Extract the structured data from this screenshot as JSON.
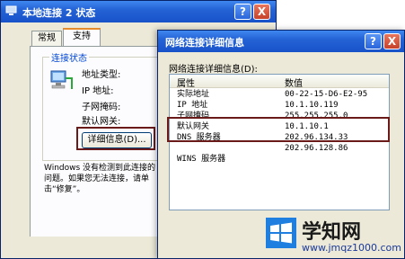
{
  "back_window": {
    "title": "本地连接 2 状态",
    "help_label": "?",
    "close_label": "X",
    "tabs": [
      "常规",
      "支持"
    ],
    "group_title": "连接状态",
    "labels": [
      "地址类型:",
      "IP 地址:",
      "子网掩码:",
      "默认网关:"
    ],
    "details_button": "详细信息(D)...",
    "message": "Windows 没有检测到此连接的问题。如果您无法连接，请单击“修复”。"
  },
  "front_window": {
    "title": "网络连接详细信息",
    "help_label": "?",
    "close_label": "X",
    "panel_label": "网络连接详细信息(D):",
    "columns": [
      "属性",
      "数值"
    ],
    "rows": [
      {
        "property": "实际地址",
        "value": "00-22-15-D6-E2-95"
      },
      {
        "property": "IP 地址",
        "value": "10.1.10.119"
      },
      {
        "property": "子网掩码",
        "value": "255.255.255.0"
      },
      {
        "property": "默认网关",
        "value": "10.1.10.1"
      },
      {
        "property": "DNS 服务器",
        "value": "202.96.134.33"
      },
      {
        "property": "",
        "value": "202.96.128.86"
      },
      {
        "property": "WINS 服务器",
        "value": ""
      }
    ]
  },
  "watermark": {
    "title": "学知网",
    "url": "www.jmqz1000.com"
  }
}
